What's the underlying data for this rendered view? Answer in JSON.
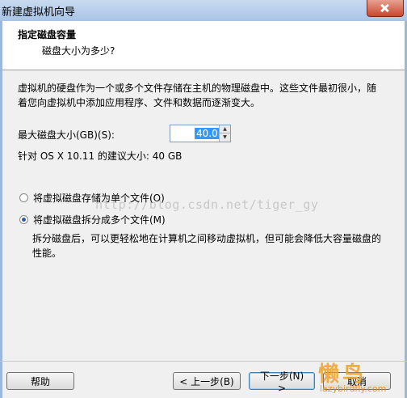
{
  "window": {
    "title": "新建虚拟机向导"
  },
  "header": {
    "title": "指定磁盘容量",
    "subtitle": "磁盘大小为多少?"
  },
  "body": {
    "description": "虚拟机的硬盘作为一个或多个文件存储在主机的物理磁盘中。这些文件最初很小，随着您向虚拟机中添加应用程序、文件和数据而逐渐变大。",
    "max_size_label": "最大磁盘大小(GB)(S):",
    "max_size_value": "40.0",
    "recommended": "针对 OS X 10.11 的建议大小: 40 GB",
    "options": [
      {
        "label": "将虚拟磁盘存储为单个文件(O)",
        "selected": false
      },
      {
        "label": "将虚拟磁盘拆分成多个文件(M)",
        "selected": true
      }
    ],
    "split_note": "拆分磁盘后，可以更轻松地在计算机之间移动虚拟机，但可能会降低大容量磁盘的性能。"
  },
  "watermark": "http://blog.csdn.net/tiger_gy",
  "logo": {
    "text": "懒鸟",
    "url": "lazybirdfly.com"
  },
  "buttons": {
    "help": "帮助",
    "back": "< 上一步(B)",
    "next": "下一步(N) >",
    "cancel": "取消"
  }
}
